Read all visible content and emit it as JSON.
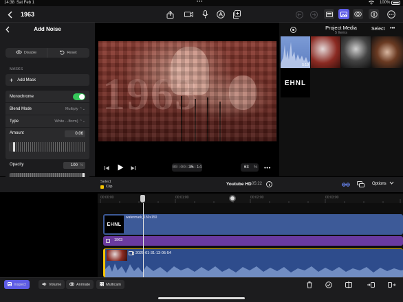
{
  "status": {
    "time": "14:38",
    "date": "Sat Feb 1",
    "battery": "100%"
  },
  "project": {
    "title": "1963"
  },
  "inspector": {
    "title": "Add Noise",
    "disable_label": "Disable",
    "reset_label": "Reset",
    "masks_header": "MASKS",
    "add_mask_label": "Add Mask",
    "monochrome_label": "Monochrome",
    "monochrome_on": true,
    "blend_mode_label": "Blend Mode",
    "blend_mode_value": "Multiply",
    "type_label": "Type",
    "type_value": "White ...lform)",
    "amount_label": "Amount",
    "amount_value": "0.06",
    "opacity_label": "Opacity",
    "opacity_value": "100",
    "opacity_unit": "%"
  },
  "viewer": {
    "year_overlay": "1963",
    "timecode_prefix": "00:00:",
    "timecode_main": "35",
    "timecode_frames": ":14",
    "zoom_value": "63",
    "zoom_unit": "%"
  },
  "browser": {
    "title": "Project Media",
    "count": "5 Items",
    "select_label": "Select",
    "thumb1_duration": "5:19",
    "logo_text": "EHNL"
  },
  "timeline_header": {
    "select_label": "Select",
    "clip_label": "Clip",
    "format": "Youtube HD",
    "duration": "05:22",
    "options_label": "Options"
  },
  "ruler": {
    "ticks": [
      "00:00:00",
      "00:01:00",
      "00:02:00",
      "00:03:00"
    ]
  },
  "tracks": {
    "watermark_name": "watermark_150x150",
    "watermark_logo": "EHNL",
    "title_name": "1963",
    "video_name": "2025-01-31-13-05-54"
  },
  "bottom": {
    "inspect_label": "Inspect",
    "volume_label": "Volume",
    "animate_label": "Animate",
    "multicam_label": "Multicam"
  },
  "colors": {
    "accent": "#5e5ce6",
    "toggle_on": "#34c759",
    "watermark_track": "#3d5a98",
    "title_track": "#6a3aa0",
    "clip_track": "#3d5a98",
    "selection": "#f5c400"
  }
}
